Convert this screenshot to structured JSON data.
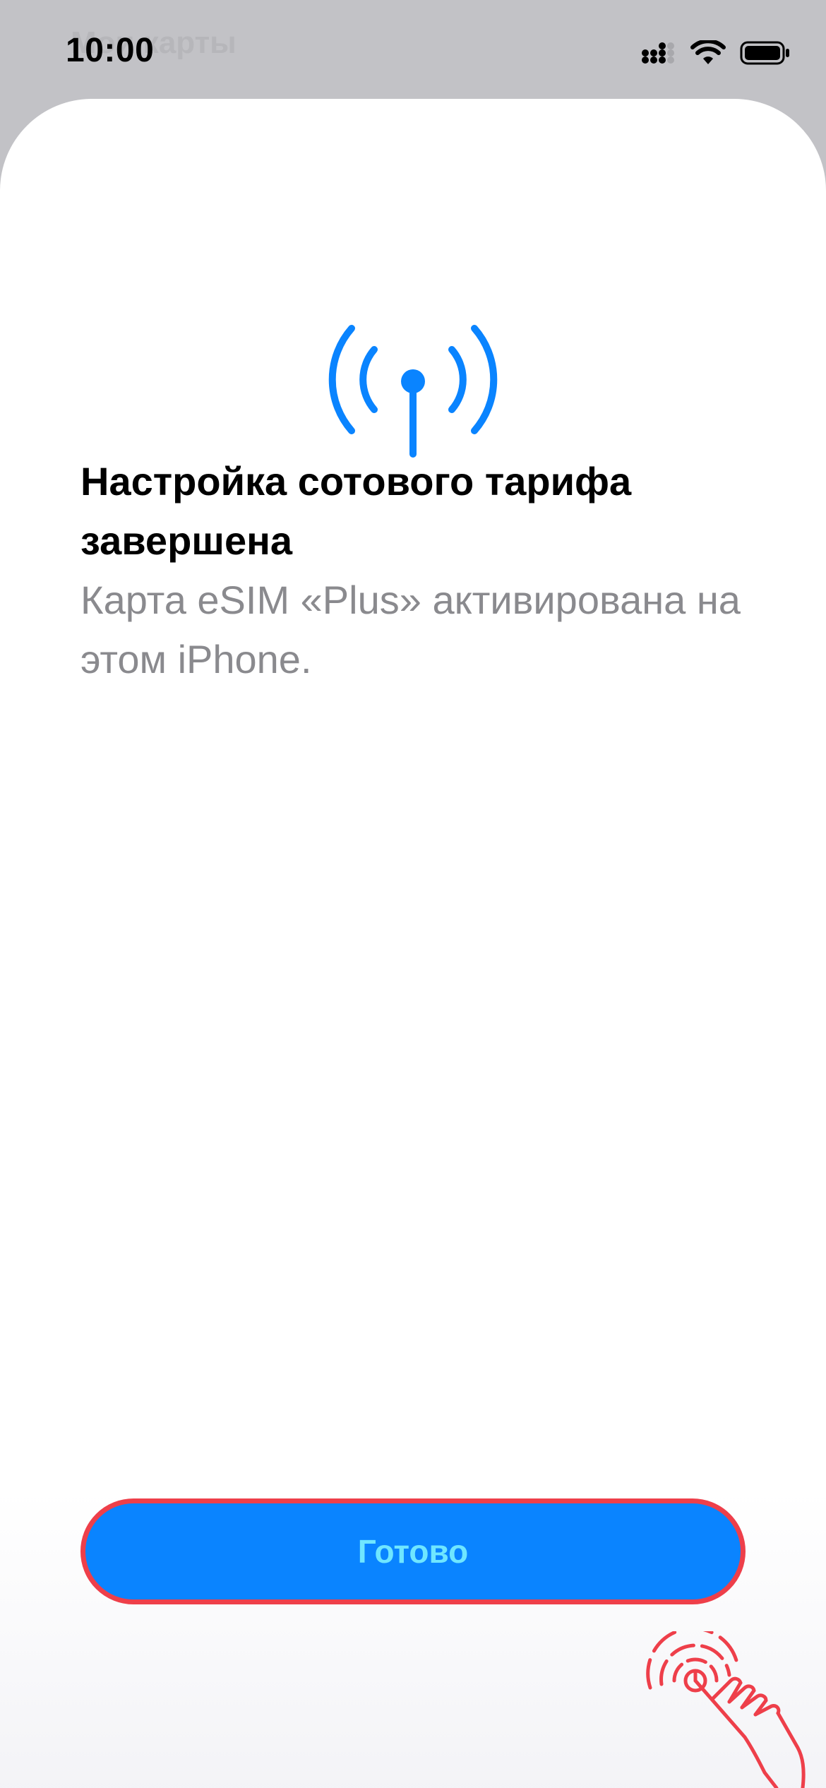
{
  "status_bar": {
    "time": "10:00",
    "ghost_text": "Мои карты",
    "icons": [
      "cellular-signal-icon",
      "wifi-icon",
      "battery-icon"
    ]
  },
  "content": {
    "icon": "antenna-signal-icon",
    "title": "Настройка сотового тарифа завершена",
    "subtitle": "Карта eSIM «Plus» активирована на этом iPhone."
  },
  "footer": {
    "done_label": "Готово"
  },
  "colors": {
    "accent": "#0A84FF",
    "highlight": "#EE3F4A",
    "button_text": "#6FE6FF",
    "secondary_text": "#8A8A8E",
    "backdrop": "#C2C2C6"
  }
}
